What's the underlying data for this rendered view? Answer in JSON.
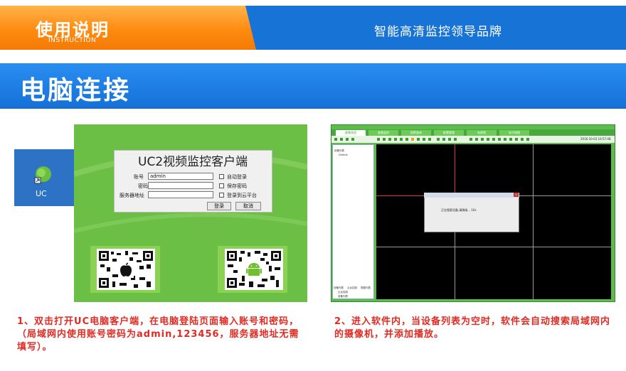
{
  "header": {
    "manual_title": "使用说明",
    "manual_sub": "INSTRUCTION",
    "tagline": "智能高清监控领导品牌",
    "accent_orange": "#ff8b10",
    "accent_blue": "#1774d6"
  },
  "section": {
    "title": "电脑连接"
  },
  "desktop": {
    "icon_label": "UC",
    "icon": "uc-app-icon"
  },
  "client": {
    "title": "UC2视频监控客户端",
    "account_label": "账号",
    "account_value": "admin",
    "password_label": "密码",
    "server_label": "服务器地址",
    "auto_login": "自动登录",
    "save_password": "保存密码",
    "login_cloud": "登录到云平台",
    "login_button": "登录",
    "cancel_button": "取消",
    "qr_icons": [
      "apple-icon",
      "android-icon"
    ]
  },
  "software": {
    "tabs": [
      "视频浏览",
      "查看监控",
      "报警查询",
      "配置管理",
      "电视墙",
      "电子地图"
    ],
    "time": "2016-10-03 16:57:48",
    "device_list": "设备列表",
    "device_default": "Default",
    "side_tabs": [
      "设备列表",
      "云台控制",
      "视图列表"
    ],
    "side_rows": [
      "云台控制",
      "设备列表"
    ],
    "dialog_text": "正在搜索设备,请稍候... 10s"
  },
  "captions": {
    "left": "1、双击打开UC电脑客户端，在电脑登陆页面输入账号和密码，（局域网内使用账号密码为admin,123456，服务器地址无需填写）。",
    "right": "2、进入软件内，当设备列表为空时，软件会自动搜索局域网内的摄像机，并添加播放。"
  }
}
